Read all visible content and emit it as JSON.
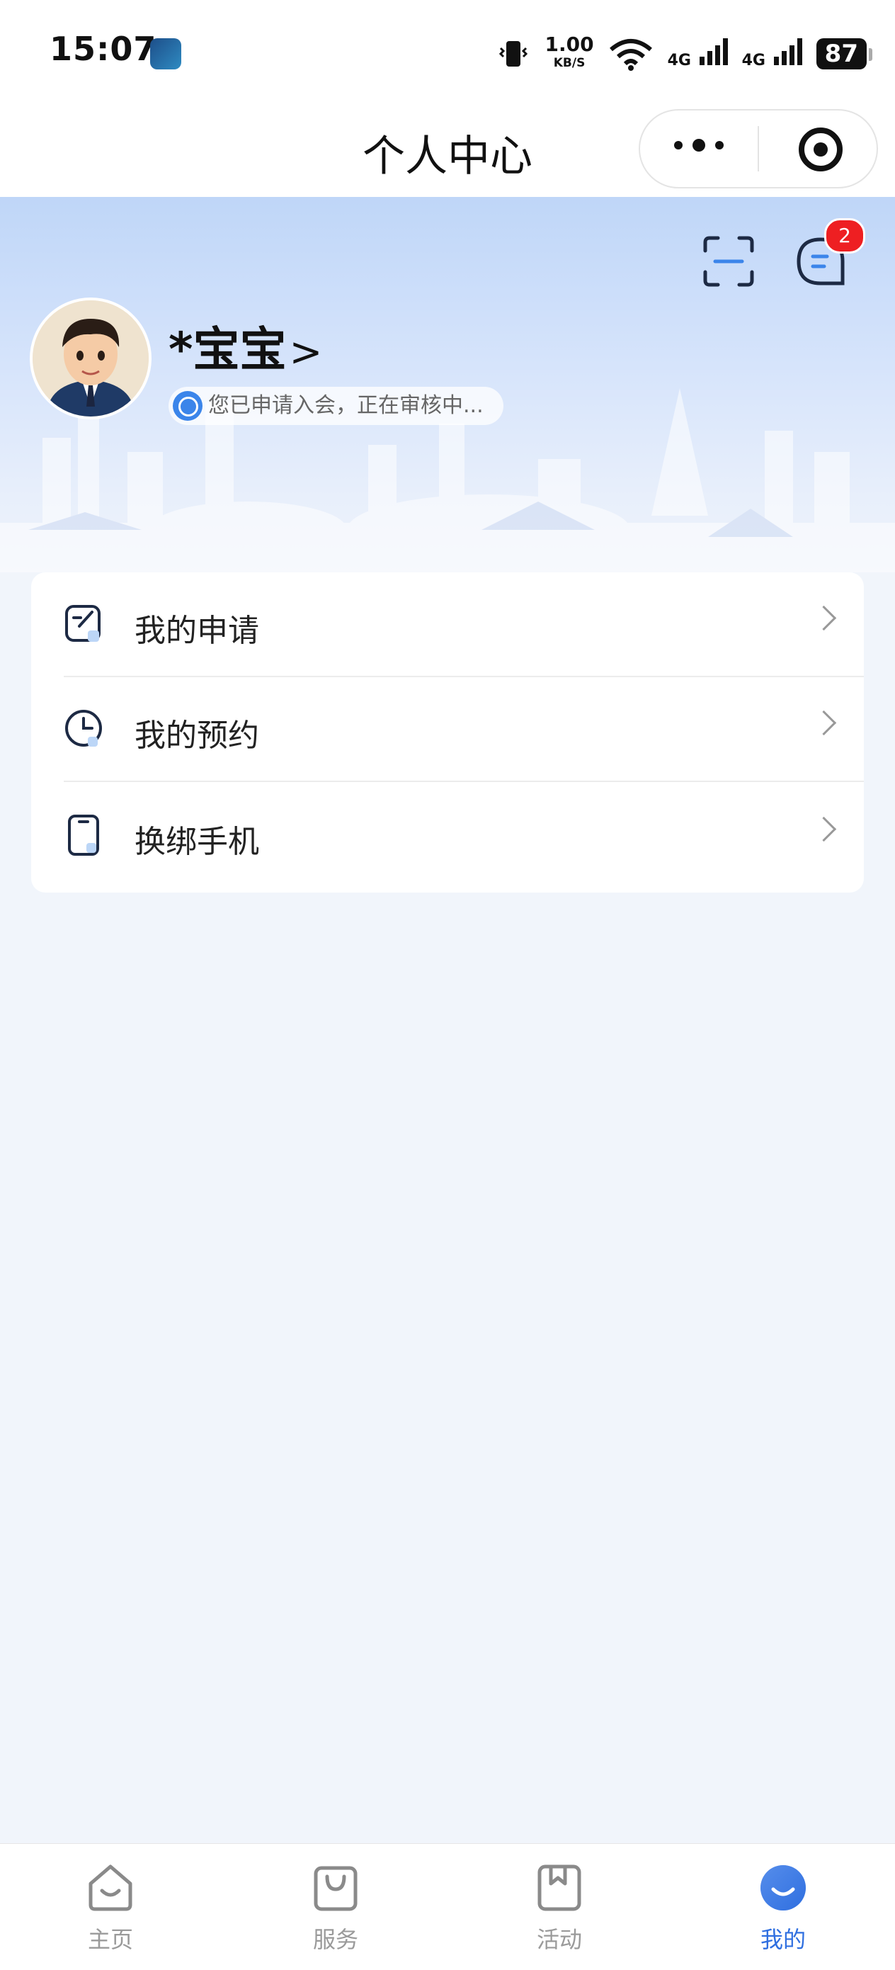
{
  "status_bar": {
    "time": "15:07",
    "net_speed_value": "1.00",
    "net_speed_unit": "KB/S",
    "sig1": "4G",
    "sig2": "4G",
    "battery": "87",
    "icons": [
      "vibrate-icon",
      "wifi-icon",
      "signal-icon",
      "signal-icon",
      "battery-icon"
    ]
  },
  "navbar": {
    "title": "个人中心",
    "more_icon": "more-dots-icon",
    "close_icon": "target-icon"
  },
  "header": {
    "scan_icon": "scan-icon",
    "message_icon": "message-icon",
    "message_badge": "2",
    "username": "*宝宝",
    "profile_chevron": ">",
    "status_text": "您已申请入会，正在审核中..."
  },
  "menu": {
    "items": [
      {
        "label": "我的申请",
        "icon": "edit-icon"
      },
      {
        "label": "我的预约",
        "icon": "clock-icon"
      },
      {
        "label": "换绑手机",
        "icon": "phone-icon"
      }
    ]
  },
  "tabbar": {
    "tabs": [
      {
        "label": "主页",
        "icon": "home-icon",
        "active": false
      },
      {
        "label": "服务",
        "icon": "bag-icon",
        "active": false
      },
      {
        "label": "活动",
        "icon": "bookmark-icon",
        "active": false
      },
      {
        "label": "我的",
        "icon": "profile-icon",
        "active": true
      }
    ],
    "active_color": "#2f6fe0",
    "inactive_color": "#9a9a9a"
  },
  "colors": {
    "accent": "#3b85ea",
    "badge": "#ee1f22",
    "background": "#f1f5fb"
  }
}
